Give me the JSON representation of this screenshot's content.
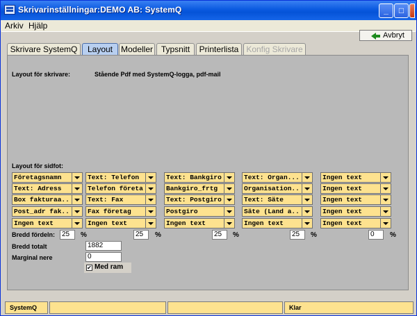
{
  "window": {
    "title": "Skrivarinställningar:DEMO AB: SystemQ",
    "minimize": "_",
    "maximize": "□",
    "close": "✕"
  },
  "menu": {
    "arkiv": "Arkiv",
    "hjalp": "Hjälp"
  },
  "toolbar": {
    "avbryt": "Avbryt"
  },
  "tabs": [
    {
      "label": "Skrivare SystemQ",
      "state": "normal"
    },
    {
      "label": "Layout",
      "state": "active"
    },
    {
      "label": "Modeller",
      "state": "normal"
    },
    {
      "label": "Typsnitt",
      "state": "normal"
    },
    {
      "label": "Printerlista",
      "state": "normal"
    },
    {
      "label": "Konfig Skrivare",
      "state": "disabled"
    }
  ],
  "layout": {
    "printer_label": "Layout för skrivare:",
    "printer_value": "Stående Pdf med SystemQ-logga, pdf-mail",
    "footer_label": "Layout för sidfot:",
    "columns": [
      [
        "Företagsnamn",
        "Text: Adress",
        "Box fakturaa...",
        "Post_adr fak...",
        "Ingen text"
      ],
      [
        "Text: Telefon",
        "Telefon företag",
        "Text: Fax",
        "Fax företag",
        "Ingen text"
      ],
      [
        "Text: Bankgiro",
        "Bankgiro_frtg",
        "Text:  Postgiro",
        "Postgiro",
        "Ingen text"
      ],
      [
        "Text:  Organ...",
        "Organisation...",
        "Text: Säte",
        "Säte (Land a...",
        "Ingen text"
      ],
      [
        "Ingen text",
        "Ingen text",
        "Ingen text",
        "Ingen text",
        "Ingen text"
      ]
    ],
    "bredd_fordeln_label": "Bredd fördeln:",
    "bredd_fordeln": [
      "25",
      "25",
      "25",
      "25",
      "0"
    ],
    "pct": "%",
    "bredd_totalt_label": "Bredd totalt",
    "bredd_totalt": "1882",
    "marginal_nere_label": "Marginal nere",
    "marginal_nere": "0",
    "med_ram_label": "Med ram",
    "med_ram_checked": true
  },
  "statusbar": [
    "SystemQ",
    "",
    "",
    "Klar"
  ]
}
